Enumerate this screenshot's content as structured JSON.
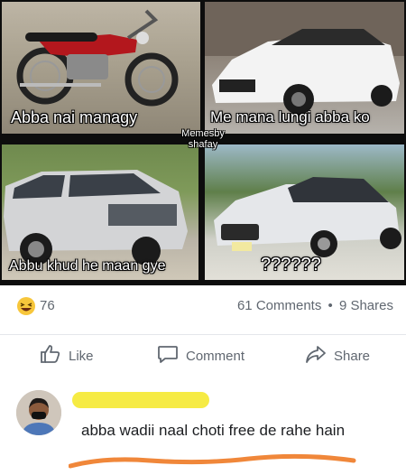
{
  "meme": {
    "panels": [
      {
        "caption": "Abba nai managy"
      },
      {
        "caption": "Me mana lungi abba ko"
      },
      {
        "caption": "Abbu khud he maan gye"
      },
      {
        "caption": "??????"
      }
    ],
    "watermark_line1": "Memesby",
    "watermark_line2": "shafay"
  },
  "stats": {
    "reaction_icon": "haha-emoji-icon",
    "reaction_count": "76",
    "comments": "61 Comments",
    "separator": "•",
    "shares": "9 Shares"
  },
  "actions": {
    "like_label": "Like",
    "comment_label": "Comment",
    "share_label": "Share"
  },
  "comment": {
    "text": "abba wadii naal choti free de rahe hain",
    "name_highlight_color": "#f5ea3a",
    "underline_color": "#f0873a"
  }
}
